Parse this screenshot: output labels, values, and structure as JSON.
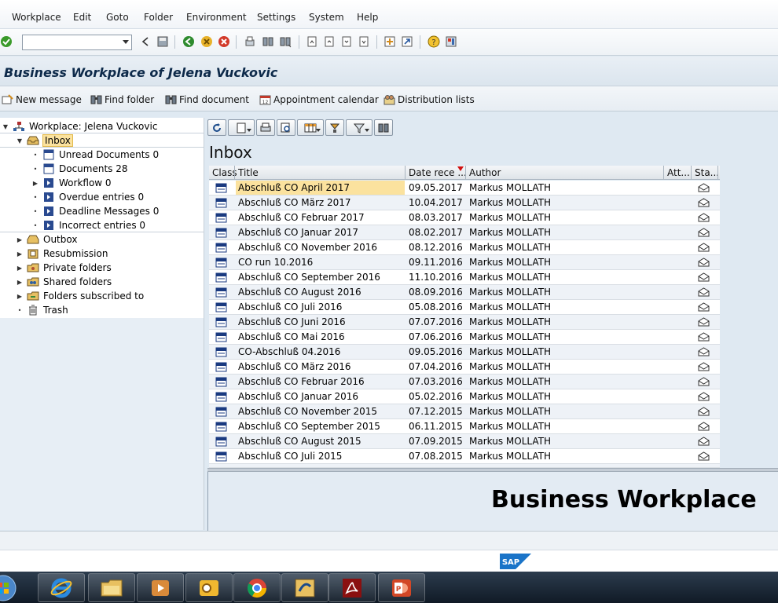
{
  "menu": {
    "items": [
      "Workplace",
      "Edit",
      "Goto",
      "Folder",
      "Environment",
      "Settings",
      "System",
      "Help"
    ]
  },
  "title": "Business Workplace of Jelena Vuckovic",
  "app_toolbar": {
    "new_message": "New message",
    "find_folder": "Find folder",
    "find_document": "Find document",
    "appointment_calendar": "Appointment calendar",
    "distribution_lists": "Distribution lists"
  },
  "tree": {
    "root": "Workplace: Jelena Vuckovic",
    "inbox": "Inbox",
    "inbox_children": [
      "Unread Documents 0",
      "Documents 28",
      "Workflow 0",
      "Overdue entries 0",
      "Deadline Messages 0",
      "Incorrect entries 0"
    ],
    "folders": [
      "Outbox",
      "Resubmission",
      "Private folders",
      "Shared folders",
      "Folders subscribed to",
      "Trash"
    ]
  },
  "inbox": {
    "heading": "Inbox",
    "columns": {
      "class": "Class",
      "title": "Title",
      "date": "Date rece ...",
      "author": "Author",
      "att": "Att...",
      "status": "Sta..."
    },
    "rows": [
      {
        "title": "Abschluß CO April 2017",
        "date": "09.05.2017",
        "author": "Markus MOLLATH"
      },
      {
        "title": "Abschluß CO März 2017",
        "date": "10.04.2017",
        "author": "Markus MOLLATH"
      },
      {
        "title": "Abschluß CO Februar 2017",
        "date": "08.03.2017",
        "author": "Markus MOLLATH"
      },
      {
        "title": "Abschluß CO Januar 2017",
        "date": "08.02.2017",
        "author": "Markus MOLLATH"
      },
      {
        "title": "Abschluß CO November 2016",
        "date": "08.12.2016",
        "author": "Markus MOLLATH"
      },
      {
        "title": "CO run 10.2016",
        "date": "09.11.2016",
        "author": "Markus MOLLATH"
      },
      {
        "title": "Abschluß CO September 2016",
        "date": "11.10.2016",
        "author": "Markus MOLLATH"
      },
      {
        "title": "Abschluß CO August 2016",
        "date": "08.09.2016",
        "author": "Markus MOLLATH"
      },
      {
        "title": "Abschluß CO Juli 2016",
        "date": "05.08.2016",
        "author": "Markus MOLLATH"
      },
      {
        "title": "Abschluß CO Juni 2016",
        "date": "07.07.2016",
        "author": "Markus MOLLATH"
      },
      {
        "title": "Abschluß CO Mai 2016",
        "date": "07.06.2016",
        "author": "Markus MOLLATH"
      },
      {
        "title": "CO-Abschluß 04.2016",
        "date": "09.05.2016",
        "author": "Markus MOLLATH"
      },
      {
        "title": "Abschluß CO März 2016",
        "date": "07.04.2016",
        "author": "Markus MOLLATH"
      },
      {
        "title": "Abschluß CO Februar 2016",
        "date": "07.03.2016",
        "author": "Markus MOLLATH"
      },
      {
        "title": "Abschluß CO Januar 2016",
        "date": "05.02.2016",
        "author": "Markus MOLLATH"
      },
      {
        "title": "Abschluß CO November 2015",
        "date": "07.12.2015",
        "author": "Markus MOLLATH"
      },
      {
        "title": "Abschluß CO September 2015",
        "date": "06.11.2015",
        "author": "Markus MOLLATH"
      },
      {
        "title": "Abschluß CO August 2015",
        "date": "07.09.2015",
        "author": "Markus MOLLATH"
      },
      {
        "title": "Abschluß CO Juli 2015",
        "date": "07.08.2015",
        "author": "Markus MOLLATH"
      }
    ]
  },
  "preview": {
    "banner": "Business Workplace"
  },
  "sap_logo": "SAP",
  "colors": {
    "selection": "#fbe29e",
    "title_text": "#0d2a4a",
    "pane_bg": "#dfe9f2"
  },
  "taskbar": {
    "apps": [
      "start-orb-icon",
      "internet-explorer-icon",
      "file-explorer-icon",
      "media-player-icon",
      "outlook-icon",
      "chrome-icon",
      "sap-logon-icon",
      "acrobat-icon",
      "powerpoint-icon"
    ]
  }
}
